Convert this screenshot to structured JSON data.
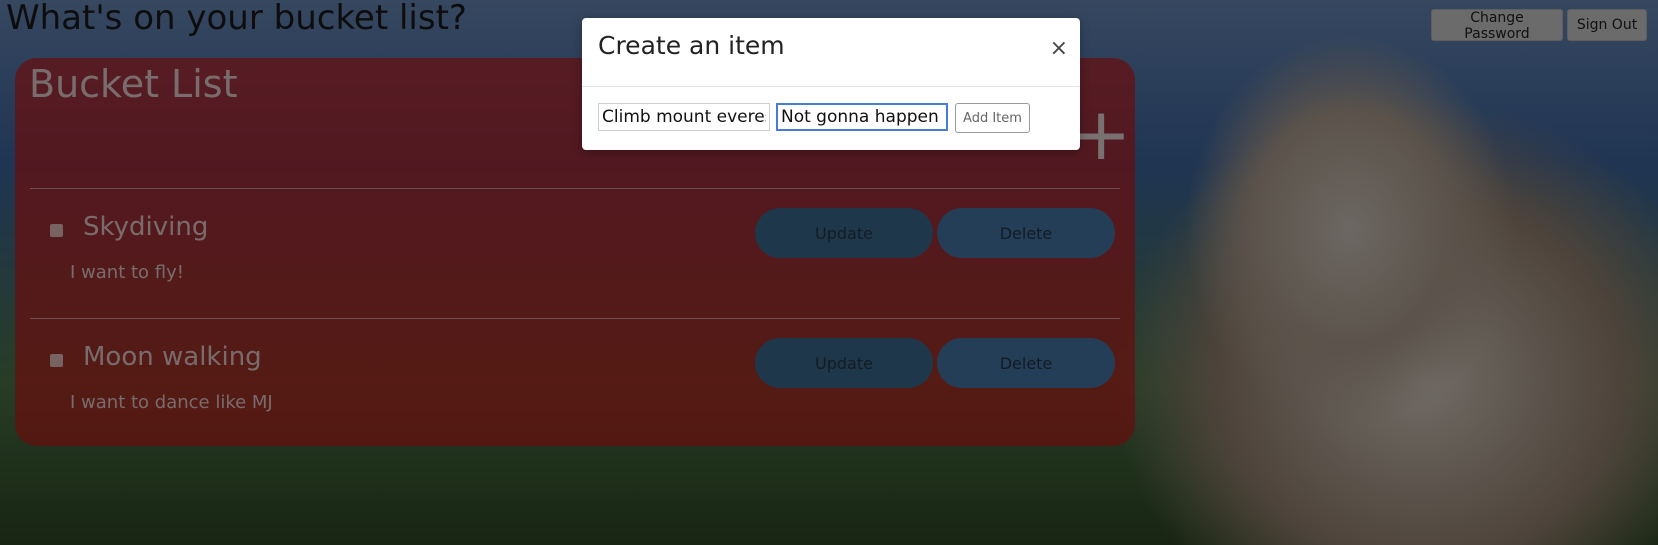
{
  "header": {
    "title": "What's on your bucket list?",
    "change_password_label": "Change Password",
    "sign_out_label": "Sign Out"
  },
  "bucket_list": {
    "title": "Bucket List",
    "add_icon": "+",
    "items": [
      {
        "title": "Skydiving",
        "description": "I want to fly!",
        "update_label": "Update",
        "delete_label": "Delete"
      },
      {
        "title": "Moon walking",
        "description": "I want to dance like MJ",
        "update_label": "Update",
        "delete_label": "Delete"
      }
    ]
  },
  "modal": {
    "title": "Create an item",
    "close_icon": "×",
    "title_input_value": "Climb mount everest",
    "description_input_value": "Not gonna happen :)",
    "add_button_label": "Add Item"
  },
  "colors": {
    "panel": "#cd1c1c",
    "pill_button": "#3f6f96",
    "focus_border": "#4b7bd8"
  }
}
